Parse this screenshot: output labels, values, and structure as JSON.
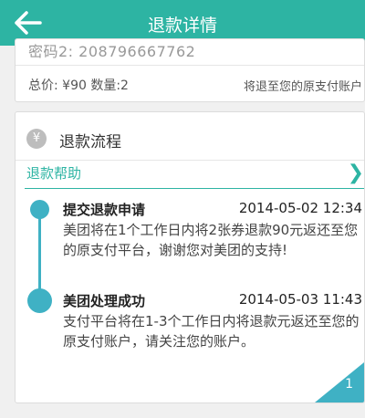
{
  "header": {
    "title": "退款详情",
    "back_icon": "arrow-left-icon"
  },
  "order": {
    "code_text": "密码2: 208796667762",
    "total_text": "总价: ¥90 数量:2",
    "refund_way": "将退至您的原支付账户"
  },
  "refund_flow": {
    "badge": "¥",
    "title": "退款流程",
    "help_label": "退款帮助",
    "help_icon": "chevron-right-icon",
    "steps": [
      {
        "title": "提交退款申请",
        "time": "2014-05-02 12:34",
        "desc": "美团将在1个工作日内将2张券退款90元返还至您的原支付平台，谢谢您对美团的支持!"
      },
      {
        "title": "美团处理成功",
        "time": "2014-05-03 11:43",
        "desc": "支付平台将在1-3个工作日内将退款元返还至您的原支付账户，请关注您的账户。"
      }
    ],
    "corner_number": "1"
  },
  "colors": {
    "accent": "#2db4a3",
    "timeline": "#3fb1c4"
  }
}
